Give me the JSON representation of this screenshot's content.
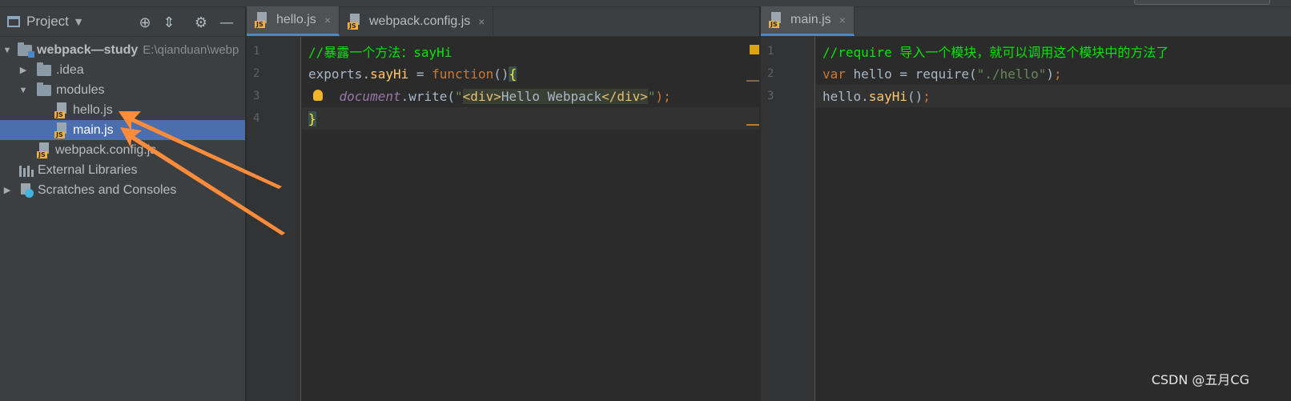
{
  "project_panel": {
    "title": "Project",
    "tree": {
      "root_name": "webpack—study",
      "root_path": "E:\\qianduan\\webp",
      "idea": ".idea",
      "modules": "modules",
      "hello": "hello.js",
      "main": "main.js",
      "config": "webpack.config.js",
      "external": "External Libraries",
      "scratches": "Scratches and Consoles"
    },
    "file_badge": "JS",
    "selected_item": "main.js"
  },
  "left_editor": {
    "tabs": [
      {
        "label": "hello.js",
        "active": true
      },
      {
        "label": "webpack.config.js",
        "active": false
      }
    ],
    "line_numbers": [
      "1",
      "2",
      "3",
      "4"
    ],
    "code": {
      "l1_comment": "//暴露一个方法：sayHi",
      "l2_obj": "exports",
      "l2_dot": ".",
      "l2_prop": "sayHi",
      "l2_eq": " = ",
      "l2_kw": "function",
      "l2_paren": "()",
      "l2_brace": "{",
      "l3_indent": "    ",
      "l3_obj": "document",
      "l3_method": ".write(",
      "l3_q1": "\"",
      "l3_tag_open": "<div>",
      "l3_text": "Hello Webpack",
      "l3_tag_close": "</div>",
      "l3_q2": "\"",
      "l3_end": ");",
      "l4_brace": "}"
    }
  },
  "right_editor": {
    "tabs": [
      {
        "label": "main.js",
        "active": true
      }
    ],
    "line_numbers": [
      "1",
      "2",
      "3"
    ],
    "code": {
      "l1_comment": "//require 导入一个模块，就可以调用这个模块中的方法了",
      "l2_kw": "var",
      "l2_mid": " hello = ",
      "l2_fn": "require",
      "l2_open": "(",
      "l2_str": "\"./hello\"",
      "l2_close": ")",
      "l2_semi": ";",
      "l3_obj": "hello.",
      "l3_fn": "sayHi",
      "l3_paren": "()",
      "l3_semi": ";"
    }
  },
  "watermark": "CSDN @五月CG",
  "colors": {
    "annotation_arrow": "#ff8c3a",
    "selection": "#4b6eaf",
    "comment": "#00e800",
    "keyword": "#cc7832"
  }
}
